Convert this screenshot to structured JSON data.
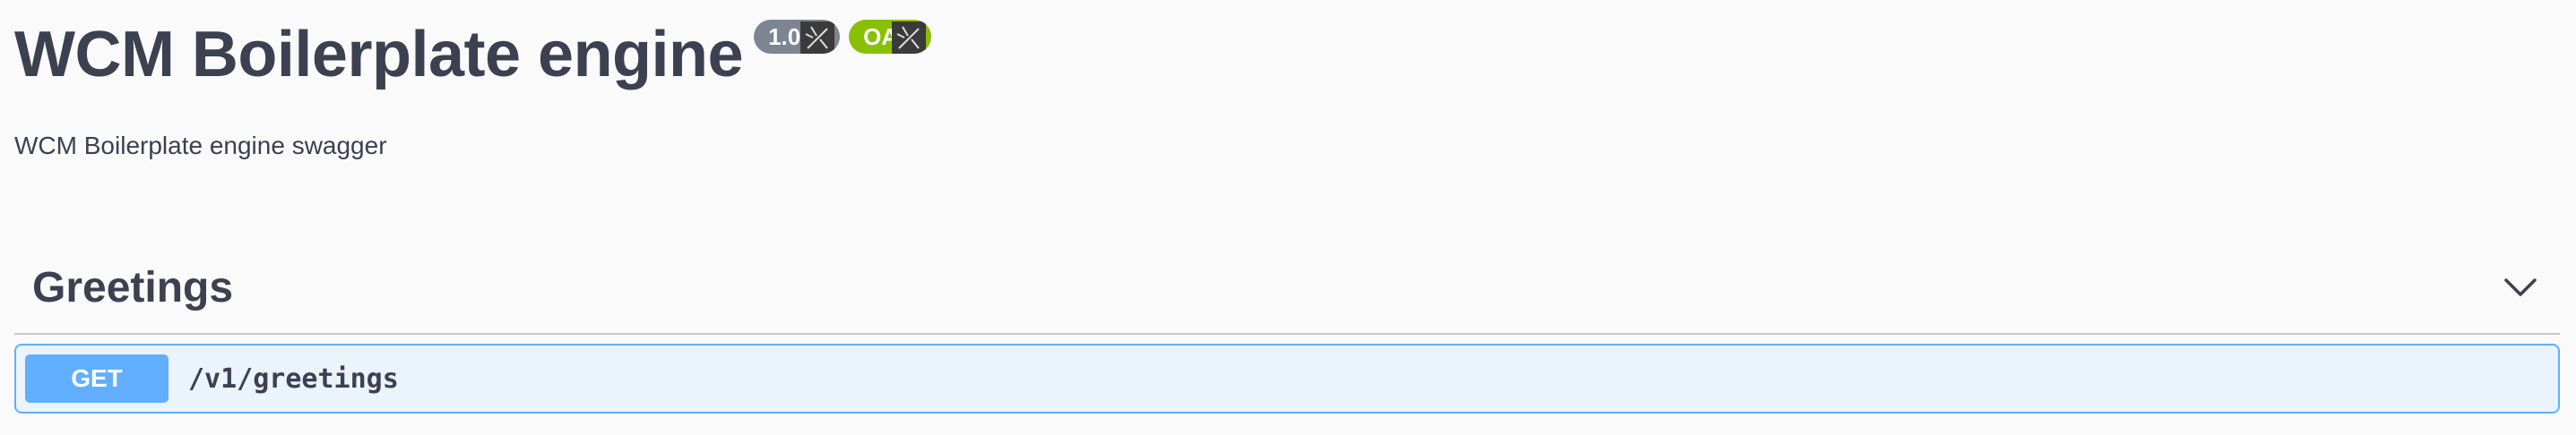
{
  "info": {
    "title": "WCM Boilerplate engine",
    "version_badge": "1.0",
    "oas_badge": "OAS",
    "description": "WCM Boilerplate engine swagger"
  },
  "tags": [
    {
      "name": "Greetings",
      "expand_icon": "chevron-down-icon",
      "operations": [
        {
          "method": "GET",
          "path": "/v1/greetings"
        }
      ]
    }
  ],
  "colors": {
    "text": "#3b4151",
    "version_badge": "#7d8492",
    "oas_badge": "#89bf04",
    "get_method": "#61affe",
    "get_background": "#ebf3fb"
  }
}
